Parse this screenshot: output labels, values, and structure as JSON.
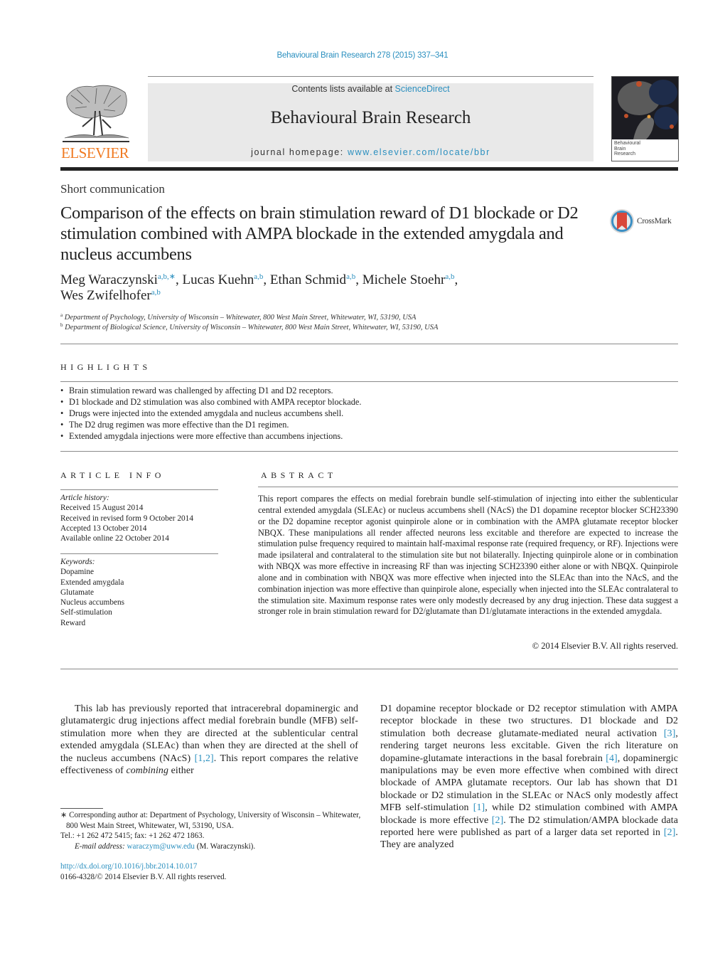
{
  "running_head": "Behavioural Brain Research 278 (2015) 337–341",
  "masthead": {
    "contents_prefix": "Contents lists available at ",
    "contents_link": "ScienceDirect",
    "journal_title": "Behavioural Brain Research",
    "homepage_prefix": "journal homepage: ",
    "homepage_link": "www.elsevier.com/locate/bbr"
  },
  "publisher_logo": {
    "wordmark": "ELSEVIER",
    "color": "#f07a22"
  },
  "cover": {
    "line1": "Behavioural",
    "line2": "Brain",
    "line3": "Research"
  },
  "article_type": "Short communication",
  "title": "Comparison of the effects on brain stimulation reward of D1 blockade or D2 stimulation combined with AMPA blockade in the extended amygdala and nucleus accumbens",
  "crossmark_label": "CrossMark",
  "authors": [
    {
      "name": "Meg Waraczynski",
      "sup": "a,b,∗",
      "sep": ", "
    },
    {
      "name": "Lucas Kuehn",
      "sup": "a,b",
      "sep": ", "
    },
    {
      "name": "Ethan Schmid",
      "sup": "a,b",
      "sep": ", "
    },
    {
      "name": "Michele Stoehr",
      "sup": "a,b",
      "sep": ","
    },
    {
      "name": "Wes Zwifelhofer",
      "sup": "a,b",
      "sep": ""
    }
  ],
  "affiliations": [
    {
      "mark": "a",
      "text": "Department of Psychology, University of Wisconsin – Whitewater, 800 West Main Street, Whitewater, WI, 53190, USA"
    },
    {
      "mark": "b",
      "text": "Department of Biological Science, University of Wisconsin – Whitewater, 800 West Main Street, Whitewater, WI, 53190, USA"
    }
  ],
  "highlights": {
    "heading": "HIGHLIGHTS",
    "items": [
      "Brain stimulation reward was challenged by affecting D1 and D2 receptors.",
      "D1 blockade and D2 stimulation was also combined with AMPA receptor blockade.",
      "Drugs were injected into the extended amygdala and nucleus accumbens shell.",
      "The D2 drug regimen was more effective than the D1 regimen.",
      "Extended amygdala injections were more effective than accumbens injections."
    ]
  },
  "article_info": {
    "heading": "ARTICLE INFO",
    "history_label": "Article history:",
    "history": [
      "Received 15 August 2014",
      "Received in revised form 9 October 2014",
      "Accepted 13 October 2014",
      "Available online 22 October 2014"
    ],
    "keywords_label": "Keywords:",
    "keywords": [
      "Dopamine",
      "Extended amygdala",
      "Glutamate",
      "Nucleus accumbens",
      "Self-stimulation",
      "Reward"
    ]
  },
  "abstract": {
    "heading": "ABSTRACT",
    "text": "This report compares the effects on medial forebrain bundle self-stimulation of injecting into either the sublenticular central extended amygdala (SLEAc) or nucleus accumbens shell (NAcS) the D1 dopamine receptor blocker SCH23390 or the D2 dopamine receptor agonist quinpirole alone or in combination with the AMPA glutamate receptor blocker NBQX. These manipulations all render affected neurons less excitable and therefore are expected to increase the stimulation pulse frequency required to maintain half-maximal response rate (required frequency, or RF). Injections were made ipsilateral and contralateral to the stimulation site but not bilaterally. Injecting quinpirole alone or in combination with NBQX was more effective in increasing RF than was injecting SCH23390 either alone or with NBQX. Quinpirole alone and in combination with NBQX was more effective when injected into the SLEAc than into the NAcS, and the combination injection was more effective than quinpirole alone, especially when injected into the SLEAc contralateral to the stimulation site. Maximum response rates were only modestly decreased by any drug injection. These data suggest a stronger role in brain stimulation reward for D2/glutamate than D1/glutamate interactions in the extended amygdala.",
    "copyright": "© 2014 Elsevier B.V. All rights reserved."
  },
  "body": {
    "left": {
      "p1": "This lab has previously reported that intracerebral dopaminergic and glutamatergic drug injections affect medial forebrain bundle (MFB) self-stimulation more when they are directed at the sublenticular central extended amygdala (SLEAc) than when they are directed at the shell of the nucleus accumbens (NAcS) ",
      "ref1": "[1,2]",
      "p2": ". This report compares the relative effectiveness of ",
      "emph": "combining",
      "p3": " either"
    },
    "right": {
      "s1": "D1 dopamine receptor blockade or D2 receptor stimulation with AMPA receptor blockade in these two structures. D1 blockade and D2 stimulation both decrease glutamate-mediated neural activation ",
      "ref1": "[3]",
      "s2": ", rendering target neurons less excitable. Given the rich literature on dopamine-glutamate interactions in the basal forebrain ",
      "ref2": "[4]",
      "s3": ", dopaminergic manipulations may be even more effective when combined with direct blockade of AMPA glutamate receptors. Our lab has shown that D1 blockade or D2 stimulation in the SLEAc or NAcS only modestly affect MFB self-stimulation ",
      "ref3": "[1]",
      "s4": ", while D2 stimulation combined with AMPA blockade is more effective ",
      "ref4": "[2]",
      "s5": ". The D2 stimulation/AMPA blockade data reported here were published as part of a larger data set reported in ",
      "ref5": "[2]",
      "s6": ". They are analyzed"
    }
  },
  "footnote": {
    "corresponding": "∗ Corresponding author at: Department of Psychology, University of Wisconsin – Whitewater, 800 West Main Street, Whitewater, WI, 53190, USA.",
    "tel": "Tel.: +1 262 472 5415; fax: +1 262 472 1863.",
    "email_label": "E-mail address: ",
    "email": "waraczym@uww.edu",
    "email_suffix": " (M. Waraczynski)."
  },
  "doi": {
    "link": "http://dx.doi.org/10.1016/j.bbr.2014.10.017",
    "issn_line": "0166-4328/© 2014 Elsevier B.V. All rights reserved."
  },
  "colors": {
    "link": "#2a8fbf",
    "elsevier_orange": "#f07a22",
    "masthead_bg": "#e9e9e9"
  }
}
